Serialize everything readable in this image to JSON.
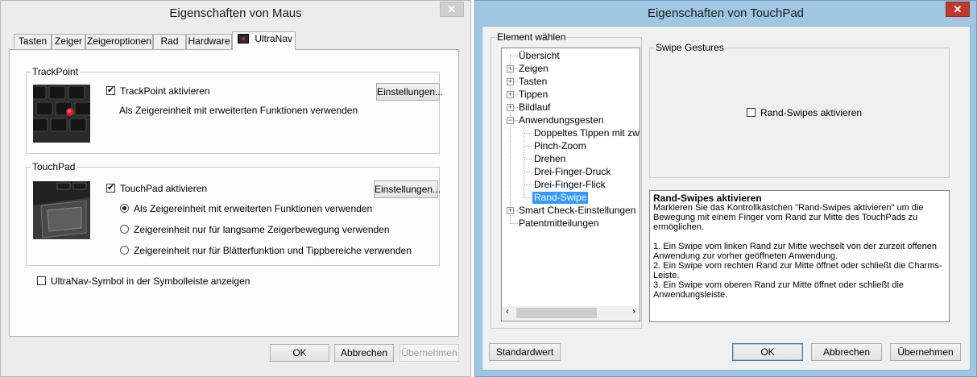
{
  "mouse_window": {
    "title": "Eigenschaften von Maus",
    "close_glyph": "✕",
    "tabs": [
      "Tasten",
      "Zeiger",
      "Zeigeroptionen",
      "Rad",
      "Hardware",
      "UltraNav"
    ],
    "active_tab": "UltraNav",
    "trackpoint": {
      "group_label": "TrackPoint",
      "enable_label": "TrackPoint aktivieren",
      "enabled": true,
      "note": "Als Zeigereinheit mit erweiterten Funktionen verwenden",
      "settings_button": "Einstellungen..."
    },
    "touchpad": {
      "group_label": "TouchPad",
      "enable_label": "TouchPad aktivieren",
      "enabled": true,
      "settings_button": "Einstellungen...",
      "options": [
        "Als Zeigereinheit mit erweiterten Funktionen verwenden",
        "Zeigereinheit nur für langsame Zeigerbewegung verwenden",
        "Zeigereinheit nur für Blätterfunktion und Tippbereiche verwenden"
      ],
      "selected_option": 0
    },
    "tray_icon_label": "UltraNav-Symbol in der Symbolleiste anzeigen",
    "tray_icon_checked": false,
    "buttons": {
      "ok": "OK",
      "cancel": "Abbrechen",
      "apply": "Übernehmen"
    }
  },
  "touchpad_window": {
    "title": "Eigenschaften von TouchPad",
    "close_glyph": "✕",
    "tree_label": "Element wählen",
    "tree": {
      "items": [
        "Übersicht",
        "Zeigen",
        "Tasten",
        "Tippen",
        "Bildlauf",
        "Anwendungsgesten",
        "Doppeltes Tippen mit zwei F",
        "Pinch-Zoom",
        "Drehen",
        "Drei-Finger-Druck",
        "Drei-Finger-Flick",
        "Rand-Swipe",
        "Smart Check-Einstellungen",
        "Patentmitteilungen"
      ],
      "selected": "Rand-Swipe"
    },
    "swipe_group_label": "Swipe Gestures",
    "edge_swipe_label": "Rand-Swipes aktivieren",
    "edge_swipe_checked": false,
    "help": {
      "heading": "Rand-Swipes aktivieren",
      "intro": "Markieren Sie das Kontrollkästchen \"Rand-Swipes aktivieren\" um die Bewegung mit einem Finger vom Rand zur Mitte des TouchPads zu ermöglichen.",
      "point1": "1. Ein Swipe vom linken Rand zur Mitte wechselt von der zurzeit offenen Anwendung zur vorher geöffneten Anwendung.",
      "point2": "2. Ein Swipe vom rechten Rand zur Mitte öffnet oder schließt die Charms-Leiste.",
      "point3": "3. Ein Swipe vom oberen Rand zur Mitte öffnet oder schließt die Anwendungsleiste."
    },
    "buttons": {
      "defaults": "Standardwert",
      "ok": "OK",
      "cancel": "Abbrechen",
      "apply": "Übernehmen"
    }
  }
}
